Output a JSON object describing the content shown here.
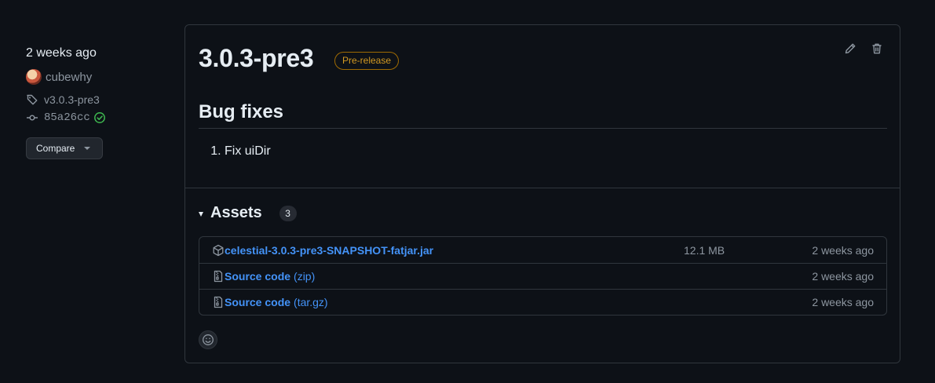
{
  "sidebar": {
    "time": "2 weeks ago",
    "author": "cubewhy",
    "tag": "v3.0.3-pre3",
    "commit": "85a26cc",
    "compare_label": "Compare"
  },
  "release": {
    "title": "3.0.3-pre3",
    "badge": "Pre-release",
    "notes_heading": "Bug fixes",
    "notes": [
      "Fix uiDir"
    ]
  },
  "assets": {
    "title": "Assets",
    "count": "3",
    "items": [
      {
        "name": "celestial-3.0.3-pre3-SNAPSHOT-fatjar.jar",
        "suffix": "",
        "size": "12.1 MB",
        "date": "2 weeks ago",
        "icon": "package-icon"
      },
      {
        "name": "Source code",
        "suffix": "(zip)",
        "size": "",
        "date": "2 weeks ago",
        "icon": "file-zip-icon"
      },
      {
        "name": "Source code",
        "suffix": "(tar.gz)",
        "size": "",
        "date": "2 weeks ago",
        "icon": "file-zip-icon"
      }
    ]
  },
  "colors": {
    "background": "#0d1117",
    "border": "#30363d",
    "link": "#4493f8",
    "prerelease": "#d29922",
    "success": "#3fb950"
  }
}
